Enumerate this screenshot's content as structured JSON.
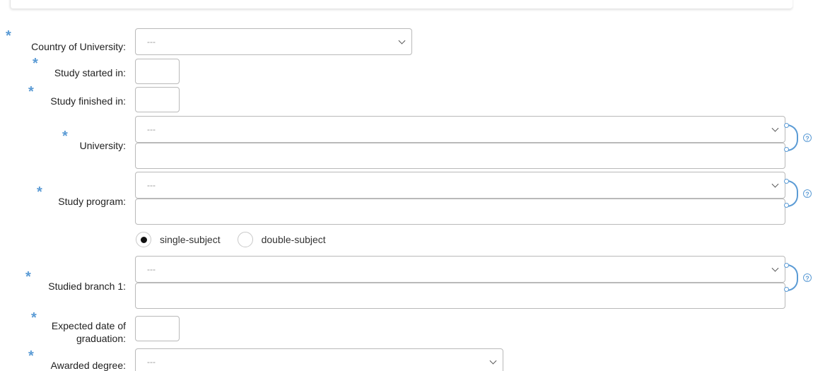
{
  "form": {
    "required_mark": "*",
    "country": {
      "label": "Country of University:",
      "value": "---"
    },
    "study_started": {
      "label": "Study started in:",
      "value": ""
    },
    "study_finished": {
      "label": "Study finished in:",
      "value": ""
    },
    "university": {
      "label": "University:",
      "select_value": "---",
      "text_value": ""
    },
    "study_program": {
      "label": "Study program:",
      "select_value": "---",
      "text_value": ""
    },
    "subject_type": {
      "options": [
        "single-subject",
        "double-subject"
      ],
      "selected": "single-subject"
    },
    "studied_branch": {
      "label": "Studied branch 1:",
      "select_value": "---",
      "text_value": ""
    },
    "expected_graduation": {
      "label_line1": "Expected date of",
      "label_line2": "graduation:",
      "value": ""
    },
    "awarded_degree": {
      "label": "Awarded degree:",
      "value": "---"
    }
  },
  "help_glyph": "?",
  "colors": {
    "accent": "#5b9bd5",
    "border": "#b9b9b9"
  }
}
